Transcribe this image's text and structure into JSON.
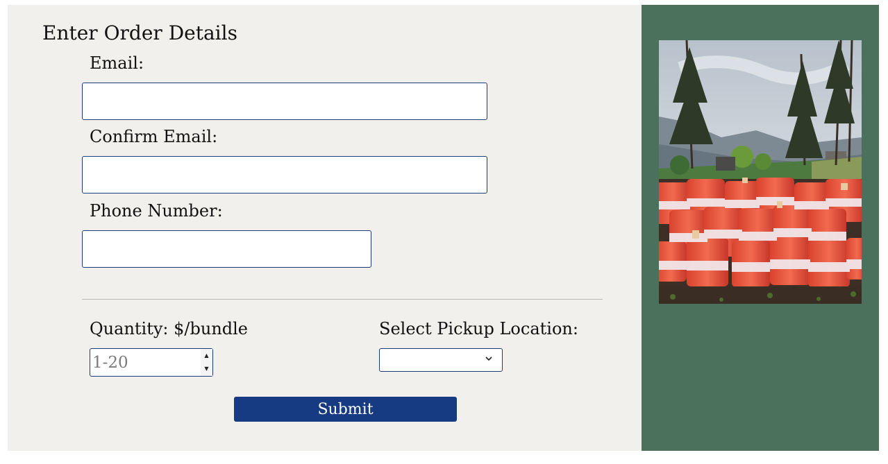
{
  "form": {
    "title": "Enter Order Details",
    "email": {
      "label": "Email:",
      "value": "",
      "placeholder": ""
    },
    "confirm_email": {
      "label": "Confirm Email:",
      "value": "",
      "placeholder": ""
    },
    "phone": {
      "label": "Phone Number:",
      "value": "",
      "placeholder": ""
    },
    "quantity": {
      "label": "Quantity: $/bundle",
      "placeholder": "1-20",
      "value": ""
    },
    "pickup": {
      "label": "Select Pickup Location:",
      "selected": ""
    },
    "submit_label": "Submit"
  },
  "side_panel": {
    "image_icon": "firewood-bundles-photo"
  },
  "colors": {
    "form_background": "#f1f0ed",
    "side_background": "#4b705c",
    "accent": "#163b82",
    "input_border": "#1b3a7a"
  }
}
